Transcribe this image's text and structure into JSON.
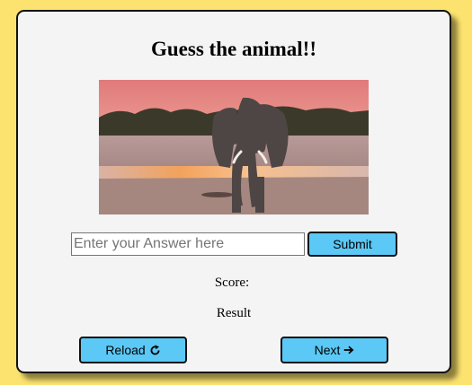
{
  "game": {
    "title": "Guess the animal!!",
    "image_subject": "elephant"
  },
  "answer": {
    "placeholder": "Enter your Answer here",
    "value": ""
  },
  "buttons": {
    "submit_label": "Submit",
    "reload_label": "Reload",
    "reload_icon": "rotate-clockwise-icon",
    "next_label": "Next",
    "next_icon": "arrow-right-icon"
  },
  "status": {
    "score_label": "Score:",
    "score_value": "",
    "result_label": "Result"
  },
  "colors": {
    "page_background": "#fce36f",
    "card_background": "#f4f4f4",
    "button_accent": "#5bc8f5"
  }
}
